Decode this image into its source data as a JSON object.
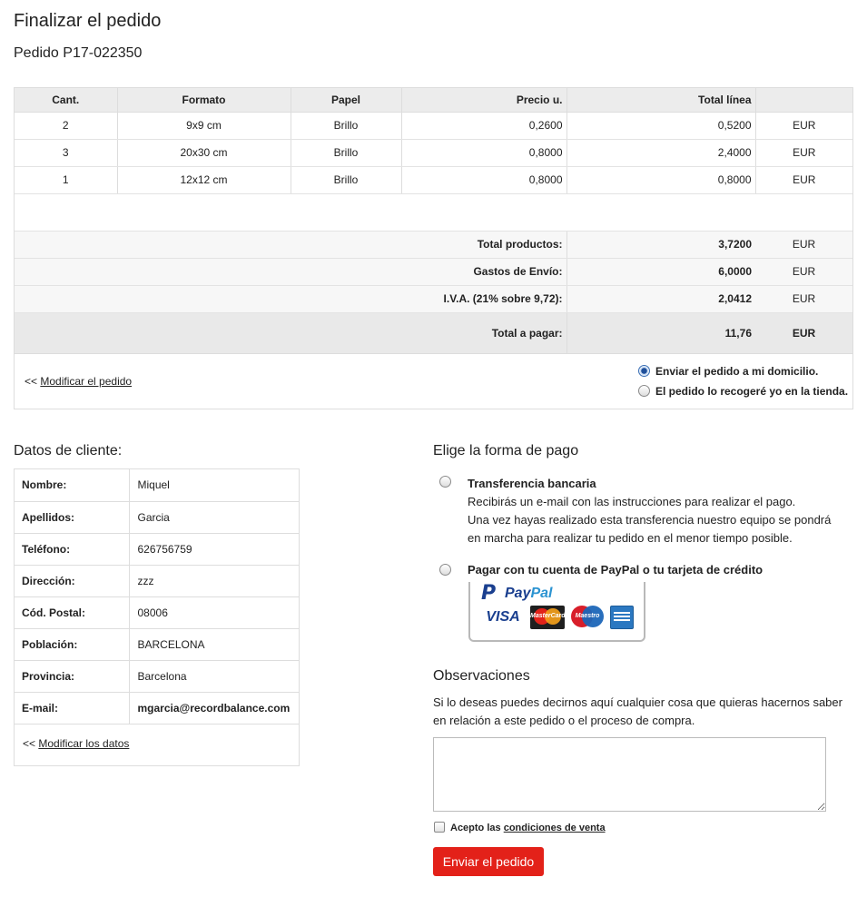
{
  "page": {
    "title": "Finalizar el pedido",
    "order_id": "Pedido P17-022350"
  },
  "order": {
    "headers": [
      "Cant.",
      "Formato",
      "Papel",
      "Precio u.",
      "Total línea",
      ""
    ],
    "rows": [
      {
        "qty": "2",
        "format": "9x9 cm",
        "paper": "Brillo",
        "unit": "0,2600",
        "total": "0,5200",
        "currency": "EUR"
      },
      {
        "qty": "3",
        "format": "20x30 cm",
        "paper": "Brillo",
        "unit": "0,8000",
        "total": "2,4000",
        "currency": "EUR"
      },
      {
        "qty": "1",
        "format": "12x12 cm",
        "paper": "Brillo",
        "unit": "0,8000",
        "total": "0,8000",
        "currency": "EUR"
      }
    ],
    "summary": [
      {
        "label": "Total productos:",
        "value": "3,7200",
        "currency": "EUR"
      },
      {
        "label": "Gastos de Envío:",
        "value": "6,0000",
        "currency": "EUR"
      },
      {
        "label": "I.V.A. (21% sobre 9,72):",
        "value": "2,0412",
        "currency": "EUR"
      }
    ],
    "grand_total": {
      "label": "Total a pagar:",
      "value": "11,76",
      "currency": "EUR"
    },
    "modify_prefix": "<<",
    "modify_link": "Modificar el pedido",
    "shipping": {
      "option_home": "Enviar el pedido a mi domicilio.",
      "option_store": "El pedido lo recogeré yo en la tienda.",
      "selected": "home"
    }
  },
  "client": {
    "title": "Datos de cliente:",
    "fields": [
      {
        "label": "Nombre:",
        "value": "Miquel"
      },
      {
        "label": "Apellidos:",
        "value": "Garcia"
      },
      {
        "label": "Teléfono:",
        "value": "626756759"
      },
      {
        "label": "Dirección:",
        "value": "zzz"
      },
      {
        "label": "Cód. Postal:",
        "value": "08006"
      },
      {
        "label": "Población:",
        "value": "BARCELONA"
      },
      {
        "label": "Provincia:",
        "value": "Barcelona"
      },
      {
        "label": "E-mail:",
        "value": "mgarcia@recordbalance.com"
      }
    ],
    "modify_prefix": "<<",
    "modify_link": "Modificar los datos"
  },
  "payment": {
    "title": "Elige la forma de pago",
    "transfer_title": "Transferencia bancaria",
    "transfer_line1": "Recibirás un e-mail con las instrucciones para realizar el pago.",
    "transfer_line2": "Una vez hayas realizado esta transferencia nuestro equipo se pondrá",
    "transfer_line3": "en marcha para realizar tu pedido en el menor tiempo posible.",
    "paypal_title": "Pagar con tu cuenta de PayPal o tu tarjeta de crédito",
    "logo": {
      "pay": "Pay",
      "pal": "Pal",
      "visa": "VISA",
      "mastercard": "MasterCard",
      "maestro": "Maestro"
    }
  },
  "observations": {
    "title": "Observaciones",
    "line1": "Si lo deseas puedes decirnos aquí cualquier cosa que quieras hacernos saber",
    "line2": "en relación a este pedido o el proceso de compra.",
    "value": ""
  },
  "terms": {
    "prefix": "Acepto las",
    "link": "condiciones de venta"
  },
  "submit_label": "Enviar el pedido"
}
